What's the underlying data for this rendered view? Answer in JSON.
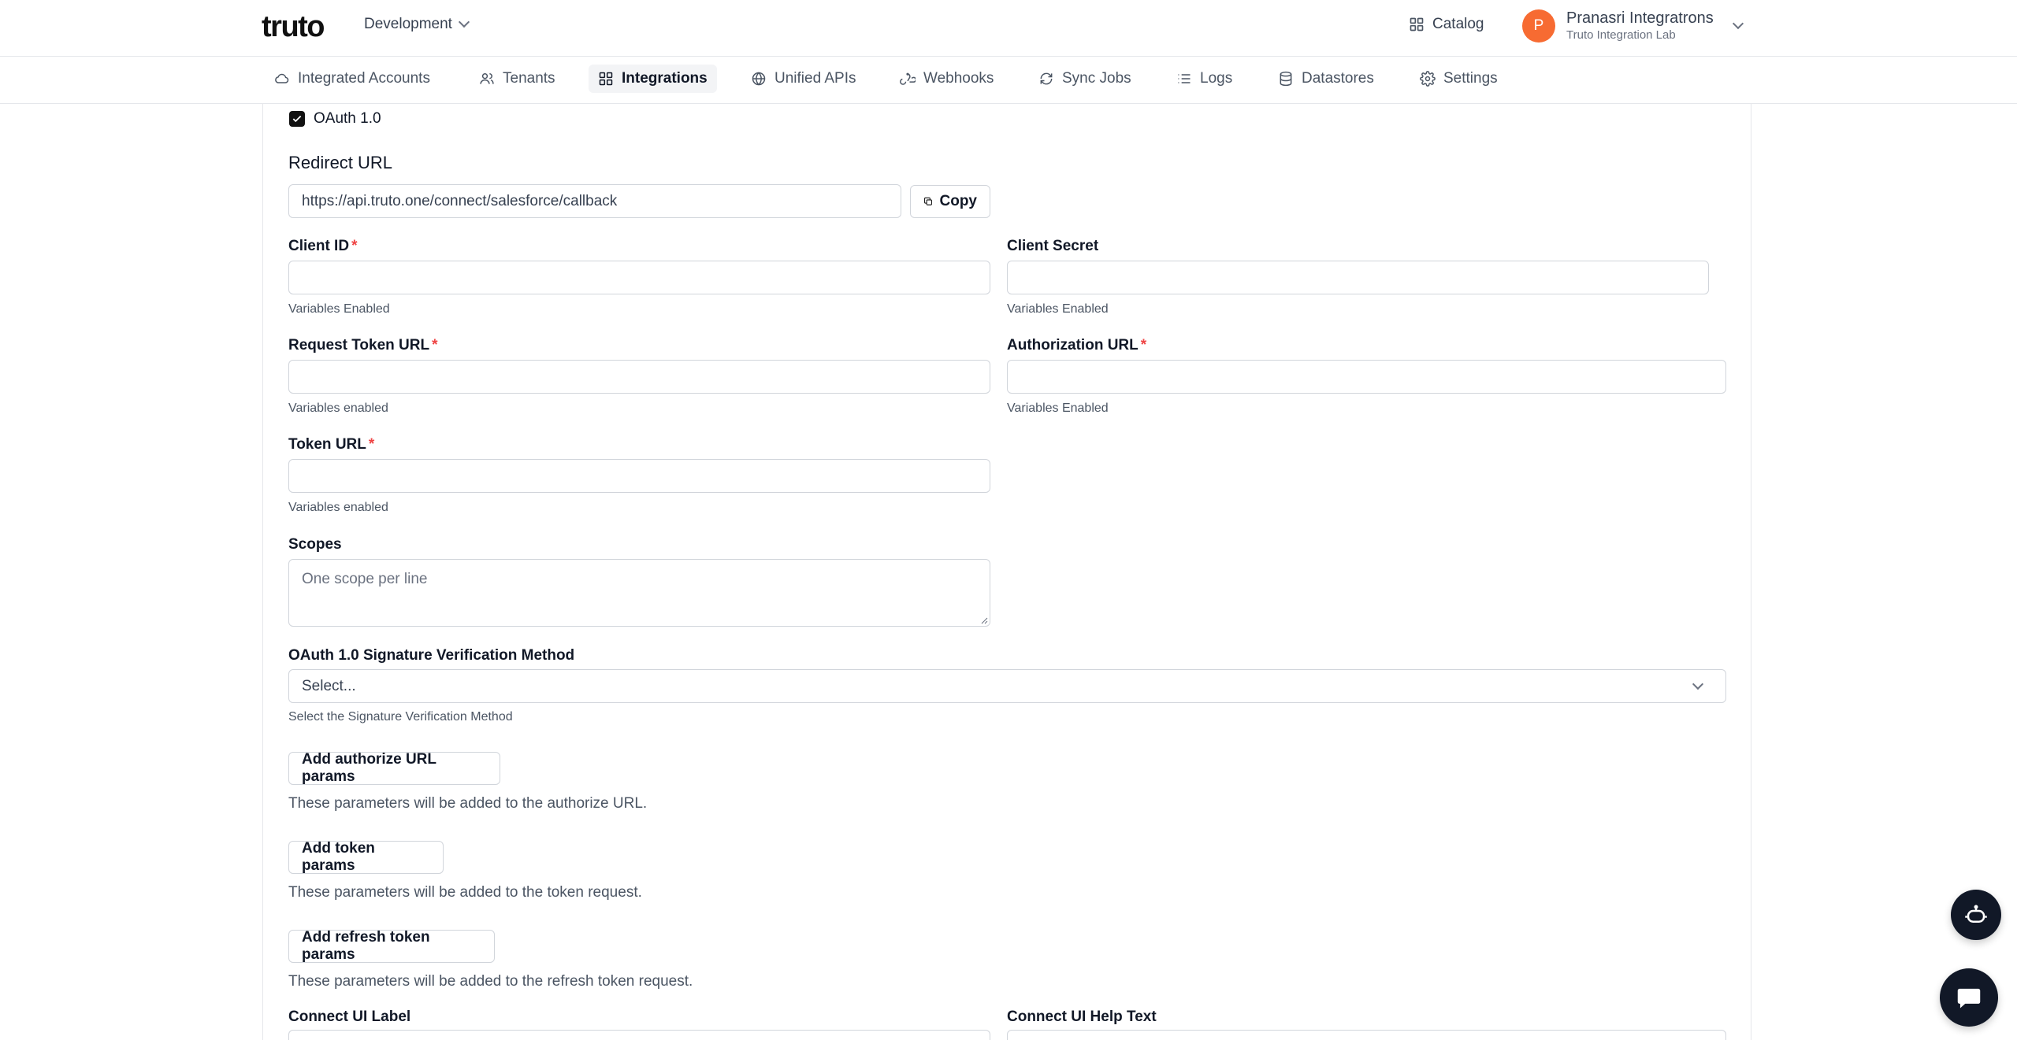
{
  "header": {
    "logo_text": "truto",
    "environment": "Development",
    "catalog_label": "Catalog",
    "user": {
      "initial": "P",
      "name": "Pranasri Integratrons",
      "org": "Truto Integration Lab",
      "avatar_color": "#f76b32"
    }
  },
  "nav": {
    "tabs": [
      {
        "label": "Integrated Accounts",
        "icon": "cloud-icon"
      },
      {
        "label": "Tenants",
        "icon": "users-icon"
      },
      {
        "label": "Integrations",
        "icon": "grid-icon",
        "active": true
      },
      {
        "label": "Unified APIs",
        "icon": "globe-icon"
      },
      {
        "label": "Webhooks",
        "icon": "webhook-icon"
      },
      {
        "label": "Sync Jobs",
        "icon": "sync-icon"
      },
      {
        "label": "Logs",
        "icon": "list-icon"
      },
      {
        "label": "Datastores",
        "icon": "database-icon"
      },
      {
        "label": "Settings",
        "icon": "gear-icon"
      }
    ]
  },
  "form": {
    "oauth_checkbox": {
      "label": "OAuth 1.0",
      "checked": true
    },
    "redirect": {
      "title": "Redirect URL",
      "value": "https://api.truto.one/connect/salesforce/callback",
      "copy_label": "Copy"
    },
    "client_id": {
      "label": "Client ID",
      "required": "*",
      "hint": "Variables Enabled"
    },
    "client_secret": {
      "label": "Client Secret",
      "hint": "Variables Enabled"
    },
    "request_token_url": {
      "label": "Request Token URL",
      "required": "*",
      "hint": "Variables enabled"
    },
    "authorization_url": {
      "label": "Authorization URL",
      "required": "*",
      "hint": "Variables Enabled"
    },
    "token_url": {
      "label": "Token URL",
      "required": "*",
      "hint": "Variables enabled"
    },
    "scopes": {
      "label": "Scopes",
      "placeholder": "One scope per line"
    },
    "signature_method": {
      "label": "OAuth 1.0 Signature Verification Method",
      "placeholder": "Select...",
      "hint": "Select the Signature Verification Method"
    },
    "authorize_params": {
      "button": "Add authorize URL params",
      "hint": "These parameters will be added to the authorize URL."
    },
    "token_params": {
      "button": "Add token params",
      "hint": "These parameters will be added to the token request."
    },
    "refresh_params": {
      "button": "Add refresh token params",
      "hint": "These parameters will be added to the refresh token request."
    },
    "connect_ui_label": {
      "label": "Connect UI Label"
    },
    "connect_ui_help": {
      "label": "Connect UI Help Text"
    }
  },
  "floating": {
    "bot_icon": "bot-icon",
    "chat_icon": "chat-icon"
  }
}
